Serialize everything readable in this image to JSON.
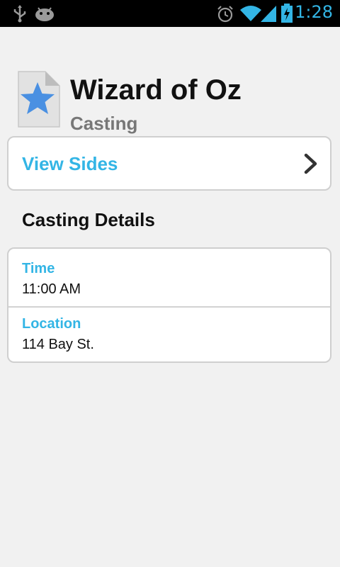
{
  "status_bar": {
    "time": "1:28",
    "icons": [
      "usb-icon",
      "android-debug-icon",
      "alarm-icon",
      "wifi-icon",
      "signal-icon",
      "battery-charging-icon"
    ]
  },
  "header": {
    "title": "Wizard of Oz",
    "subtitle": "Casting",
    "icon": "star-document-icon"
  },
  "view_sides": {
    "label": "View Sides",
    "icon": "chevron-right-icon"
  },
  "casting_details": {
    "section_title": "Casting Details",
    "rows": [
      {
        "label": "Time",
        "value": "11:00 AM"
      },
      {
        "label": "Location",
        "value": "114 Bay St."
      }
    ]
  },
  "colors": {
    "accent": "#33b5e5",
    "background": "#f1f1f1",
    "status_bar": "#000000"
  }
}
